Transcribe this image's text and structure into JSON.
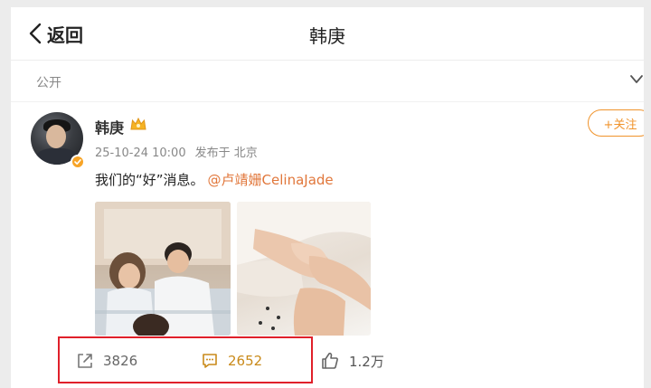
{
  "navbar": {
    "back_label": "返回",
    "title": "韩庚"
  },
  "visibility": {
    "label": "公开"
  },
  "post": {
    "author": "韩庚",
    "date": "25-10-24 10:00",
    "source": "发布于 北京",
    "follow_label": "+关注",
    "text": "我们的“好”消息。",
    "mention": "@卢靖姗CelinaJade",
    "photo_count": 2
  },
  "stats": {
    "forward_count": "3826",
    "comment_count": "2652",
    "like_count": "1.2万"
  },
  "colors": {
    "accent": "#f0932b",
    "mention": "#e1773b",
    "highlight": "#e0202a"
  },
  "icons": [
    "back-chevron-icon",
    "chevron-down-icon",
    "verified-icon",
    "crown-icon",
    "forward-icon",
    "comment-icon",
    "like-icon"
  ]
}
